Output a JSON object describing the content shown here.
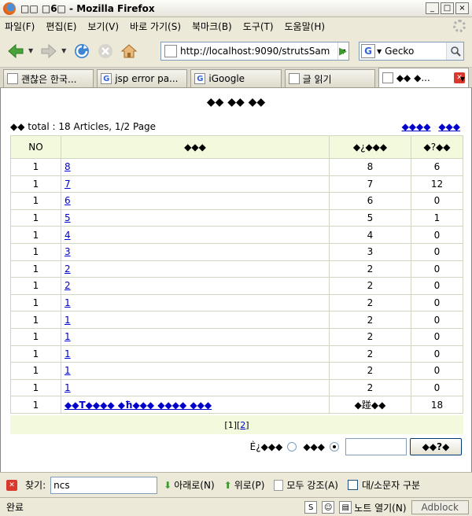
{
  "window": {
    "title": "□□ □6□ - Mozilla Firefox",
    "controls": [
      "_",
      "□",
      "×"
    ]
  },
  "menu": [
    "파일(F)",
    "편집(E)",
    "보기(V)",
    "바로 가기(S)",
    "북마크(B)",
    "도구(T)",
    "도움말(H)"
  ],
  "nav": {
    "url": "http://localhost:9090/strutsSam",
    "search_engine": "G",
    "search_text": "Gecko"
  },
  "tabs": [
    {
      "label": "괜찮은 한국...",
      "icon": "gecko-favicon-icon"
    },
    {
      "label": "jsp error pa...",
      "icon": "google-favicon-icon"
    },
    {
      "label": "iGoogle",
      "icon": "google-favicon-icon"
    },
    {
      "label": "글 읽기",
      "icon": "page-icon"
    },
    {
      "label": "◆◆ ◆...",
      "icon": "page-icon",
      "active": true
    }
  ],
  "page": {
    "heading": "◆◆ ◆◆ ◆◆",
    "summary_prefix": "◆◆",
    "summary": "total : 18 Articles, 1/2 Page",
    "top_link_1": "◆◆◆◆",
    "top_link_2": "◆◆◆",
    "columns": {
      "no": "NO",
      "title": "◆◆◆",
      "writer": "◆¿◆◆◆",
      "hit": "◆?◆◆"
    },
    "rows": [
      {
        "no": "1",
        "title": "8",
        "writer": "8",
        "hit": "6"
      },
      {
        "no": "1",
        "title": "7",
        "writer": "7",
        "hit": "12"
      },
      {
        "no": "1",
        "title": "6",
        "writer": "6",
        "hit": "0"
      },
      {
        "no": "1",
        "title": "5",
        "writer": "5",
        "hit": "1"
      },
      {
        "no": "1",
        "title": "4",
        "writer": "4",
        "hit": "0"
      },
      {
        "no": "1",
        "title": "3",
        "writer": "3",
        "hit": "0"
      },
      {
        "no": "1",
        "title": "2",
        "writer": "2",
        "hit": "0"
      },
      {
        "no": "1",
        "title": "2",
        "writer": "2",
        "hit": "0"
      },
      {
        "no": "1",
        "title": "1",
        "writer": "2",
        "hit": "0"
      },
      {
        "no": "1",
        "title": "1",
        "writer": "2",
        "hit": "0"
      },
      {
        "no": "1",
        "title": "1",
        "writer": "2",
        "hit": "0"
      },
      {
        "no": "1",
        "title": "1",
        "writer": "2",
        "hit": "0"
      },
      {
        "no": "1",
        "title": "1",
        "writer": "2",
        "hit": "0"
      },
      {
        "no": "1",
        "title": "1",
        "writer": "2",
        "hit": "0"
      },
      {
        "no": "1",
        "title": "◆◆T◆◆◆◆ ◆ħ◆◆◆ ◆◆◆◆ ◆◆◆",
        "writer": "◆踫◆◆",
        "hit": "18",
        "bold": true
      }
    ],
    "pager": {
      "current": "[1]",
      "next": "2"
    },
    "search": {
      "option_1": "Ѐ¿◆◆◆",
      "option_2": "◆◆◆",
      "submit": "◆◆?◆"
    }
  },
  "findbar": {
    "label": "찾기:",
    "value": "ncs",
    "down": "아래로(N)",
    "up": "위로(P)",
    "highlight": "모두 강조(A)",
    "match_case": "대/소문자 구분"
  },
  "status": {
    "text": "완료",
    "note": "노트 열기(N)",
    "adblock": "Adblock"
  }
}
